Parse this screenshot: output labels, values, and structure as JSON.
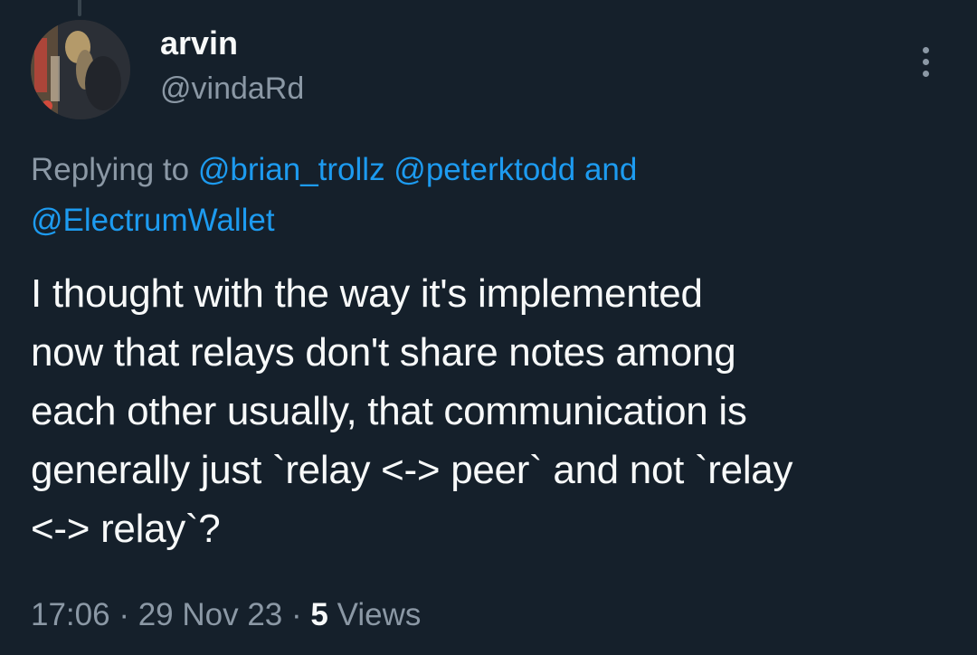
{
  "user": {
    "display_name": "arvin",
    "handle": "@vindaRd"
  },
  "reply": {
    "prefix": "Replying to",
    "mentions": [
      "@brian_trollz",
      "@peterktodd",
      "@ElectrumWallet"
    ],
    "conjunction": "and"
  },
  "tweet": {
    "lines": [
      "I thought with the way it's implemented",
      "now that relays don't share notes among",
      "each other usually, that communication is",
      "generally just `relay <-> peer` and not `relay",
      "<-> relay`?"
    ]
  },
  "meta": {
    "time": "17:06",
    "separator": "·",
    "date": "29 Nov 23",
    "views_count": "5",
    "views_label": "Views"
  },
  "colors": {
    "background": "#15202b",
    "primary_text": "#f7f9f9",
    "secondary_text": "#8b98a5",
    "accent": "#1d9bf0"
  },
  "icons": {
    "more": "more-dots-icon"
  }
}
